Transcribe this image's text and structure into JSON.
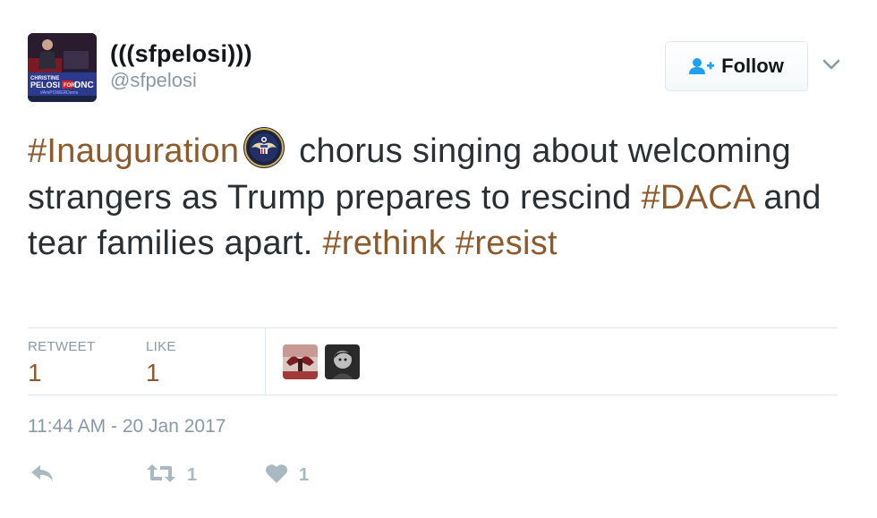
{
  "user": {
    "display_name": "(((sfpelosi)))",
    "handle": "@sfpelosi",
    "avatar_text": {
      "line1": "CHRISTINE",
      "line2": "PELOSI",
      "line3": "FOR",
      "line4": "DNC",
      "line5": "#AmPOWERDems"
    }
  },
  "follow": {
    "label": "Follow"
  },
  "tweet": {
    "hashtag1": "#Inauguration",
    "seg1": " chorus singing about welcoming strangers as Trump prepares to rescind ",
    "hashtag2": "#DACA",
    "seg2": " and tear families apart. ",
    "hashtag3": "#rethink",
    "seg3": " ",
    "hashtag4": "#resist",
    "emoji_icon": "presidential-seal-icon"
  },
  "stats": {
    "retweet_label": "RETWEET",
    "retweet_count": "1",
    "like_label": "LIKE",
    "like_count": "1"
  },
  "timestamp": "11:44 AM - 20 Jan 2017",
  "actions": {
    "reply_icon": "reply-icon",
    "retweet_icon": "retweet-icon",
    "retweet_count": "1",
    "like_icon": "heart-icon",
    "like_count": "1"
  },
  "colors": {
    "link": "#8c5a2b",
    "muted": "#8899a6",
    "action": "#aab8c2",
    "follow_icon": "#1da1f2"
  }
}
